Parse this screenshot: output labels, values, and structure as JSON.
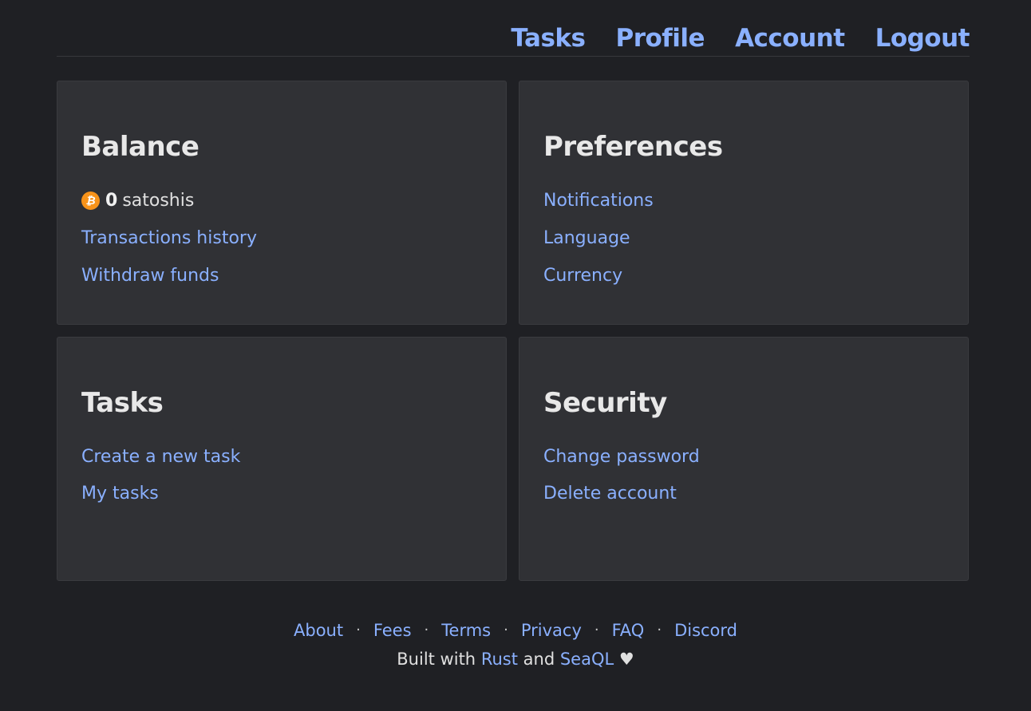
{
  "nav": {
    "tasks": "Tasks",
    "profile": "Profile",
    "account": "Account",
    "logout": "Logout"
  },
  "cards": {
    "balance": {
      "title": "Balance",
      "icon": "bitcoin-icon",
      "amount": "0",
      "unit": "satoshis",
      "links": [
        "Transactions history",
        "Withdraw funds"
      ]
    },
    "preferences": {
      "title": "Preferences",
      "links": [
        "Notifications",
        "Language",
        "Currency"
      ]
    },
    "tasks": {
      "title": "Tasks",
      "links": [
        "Create a new task",
        "My tasks"
      ]
    },
    "security": {
      "title": "Security",
      "links": [
        "Change password",
        "Delete account"
      ]
    }
  },
  "footer": {
    "links": [
      "About",
      "Fees",
      "Terms",
      "Privacy",
      "FAQ",
      "Discord"
    ],
    "separator": "·",
    "built_prefix": "Built with",
    "rust": "Rust",
    "and": "and",
    "seaql": "SeaQL",
    "heart": "♥"
  },
  "colors": {
    "background": "#1f2024",
    "card": "#303135",
    "link": "#8ab0ff",
    "bitcoin": "#f7931a"
  }
}
